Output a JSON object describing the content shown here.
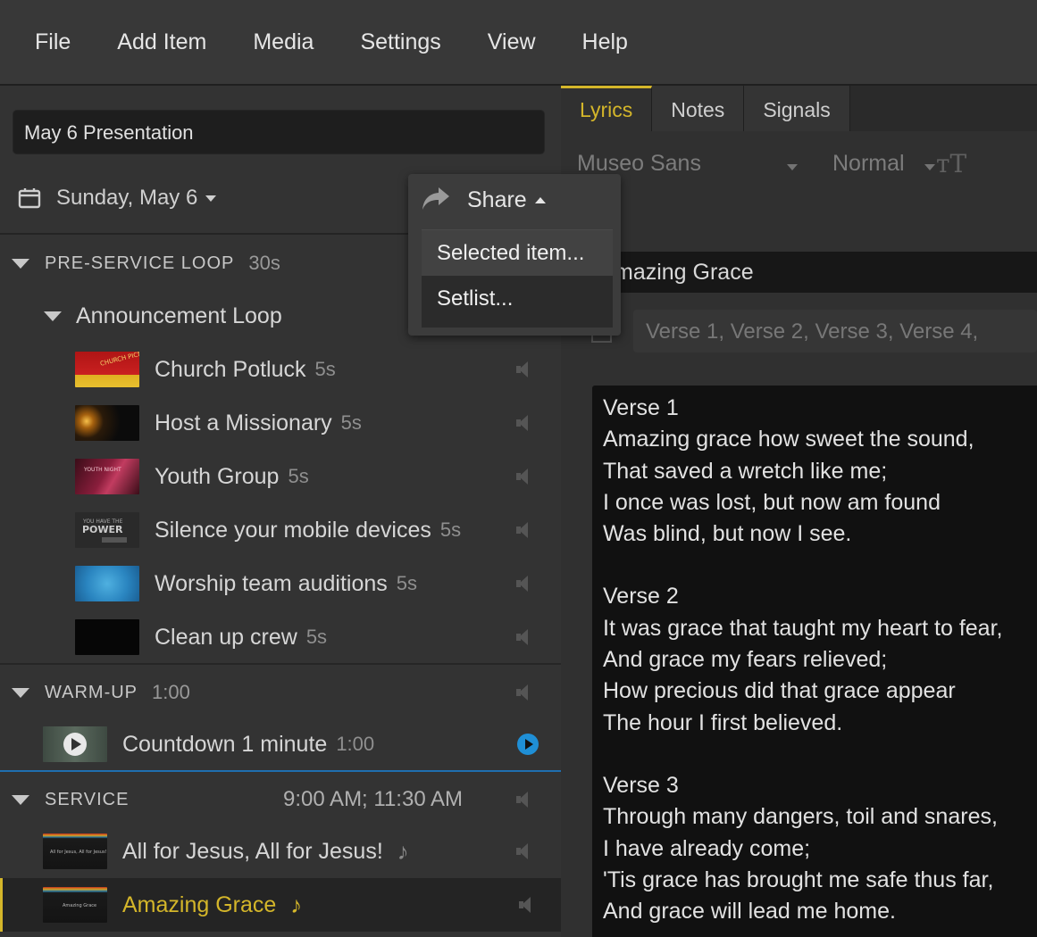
{
  "menu": [
    "File",
    "Add Item",
    "Media",
    "Settings",
    "View",
    "Help"
  ],
  "presentation_name": "May 6 Presentation",
  "date_label": "Sunday, May 6",
  "share": {
    "label": "Share",
    "options": [
      "Selected item...",
      "Setlist..."
    ]
  },
  "sections": {
    "preservice": {
      "title": "PRE-SERVICE LOOP",
      "duration": "30s"
    },
    "announcement": {
      "title": "Announcement Loop"
    },
    "warmup": {
      "title": "WARM-UP",
      "duration": "1:00"
    },
    "service": {
      "title": "SERVICE",
      "times": "9:00 AM; 11:30 AM"
    }
  },
  "items": [
    {
      "title": "Church Potluck",
      "duration": "5s"
    },
    {
      "title": "Host a Missionary",
      "duration": "5s"
    },
    {
      "title": "Youth Group",
      "duration": "5s"
    },
    {
      "title": "Silence your mobile devices",
      "duration": "5s"
    },
    {
      "title": "Worship team auditions",
      "duration": "5s"
    },
    {
      "title": "Clean up crew",
      "duration": "5s"
    },
    {
      "title": "Countdown 1 minute",
      "duration": "1:00"
    },
    {
      "title": "All for Jesus, All for Jesus!",
      "duration": ""
    },
    {
      "title": "Amazing Grace",
      "duration": ""
    }
  ],
  "tabs": [
    "Lyrics",
    "Notes",
    "Signals"
  ],
  "toolbar": {
    "font": "Museo Sans",
    "style": "Normal"
  },
  "song_title": "mazing Grace",
  "arrangement": "Verse 1, Verse 2, Verse 3, Verse 4,",
  "lyrics": [
    [
      "Verse 1",
      "Amazing grace how sweet the sound,",
      "That saved a wretch like me;",
      "I once was lost, but now am found",
      "Was blind, but now I see."
    ],
    [
      "Verse 2",
      "It was grace that taught my heart to fear,",
      "And grace my fears relieved;",
      "How precious did that grace appear",
      "The hour I first believed."
    ],
    [
      "Verse 3",
      "Through many dangers, toil and snares,",
      "I have already come;",
      "'Tis grace has brought me safe thus far,",
      "And grace will lead me home."
    ]
  ],
  "colors": {
    "accent": "#d4b62a",
    "play_blue": "#1f8fd6",
    "bg": "#2f2f2f"
  }
}
